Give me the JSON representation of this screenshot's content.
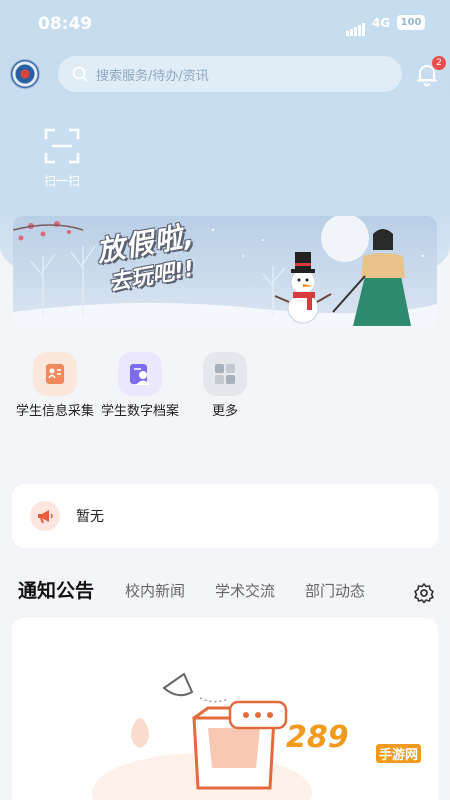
{
  "status_bar": {
    "time": "08:49",
    "network": "4G",
    "battery": "100"
  },
  "header": {
    "search_placeholder": "搜索服务/待办/资讯",
    "notification_count": "2"
  },
  "scan": {
    "label": "扫一扫"
  },
  "banner": {
    "line1": "放假啦,",
    "line2": "去玩吧!!"
  },
  "quick_menu": [
    {
      "label": "学生信息采集",
      "icon": "id-card-icon",
      "color": "#f08a5d"
    },
    {
      "label": "学生数字档案",
      "icon": "profile-icon",
      "color": "#7c6cf0"
    },
    {
      "label": "更多",
      "icon": "grid-icon",
      "color": "#a8b0bc"
    }
  ],
  "notice": {
    "text": "暂无"
  },
  "tabs": {
    "items": [
      "通知公告",
      "校内新闻",
      "学术交流",
      "部门动态"
    ],
    "active": 0
  },
  "watermark": {
    "brand": "289",
    "sub": "手游网"
  },
  "colors": {
    "accent": "#c6dcef",
    "notice": "#ee5a3c"
  }
}
